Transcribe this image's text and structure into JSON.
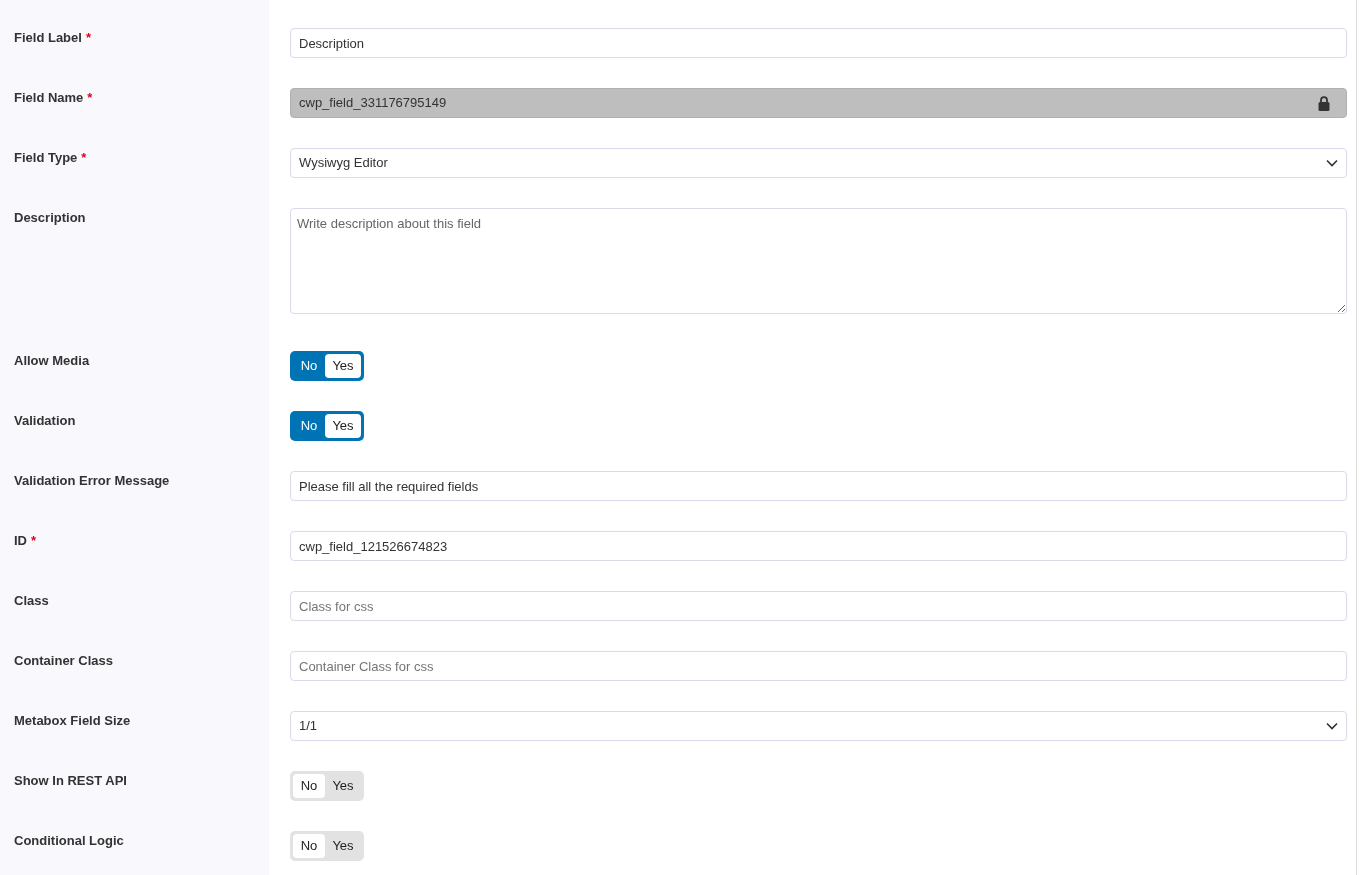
{
  "fields": [
    {
      "kind": "text",
      "label": "Field Label",
      "required_mark": "*",
      "value": "Description"
    },
    {
      "kind": "locked",
      "label": "Field Name",
      "required_mark": "*",
      "value": "cwp_field_331176795149"
    },
    {
      "kind": "select",
      "label": "Field Type",
      "required_mark": "*",
      "value": "Wysiwyg Editor"
    },
    {
      "kind": "textarea",
      "label": "Description",
      "placeholder": "Write description about this field"
    },
    {
      "kind": "toggle",
      "label": "Allow Media",
      "off_label": "No",
      "on_label": "Yes",
      "on": true
    },
    {
      "kind": "toggle",
      "label": "Validation",
      "off_label": "No",
      "on_label": "Yes",
      "on": true
    },
    {
      "kind": "text",
      "label": "Validation Error Message",
      "value": "Please fill all the required fields"
    },
    {
      "kind": "text",
      "label": "ID",
      "required_mark": "*",
      "value": "cwp_field_121526674823"
    },
    {
      "kind": "text",
      "label": "Class",
      "placeholder": "Class for css"
    },
    {
      "kind": "text",
      "label": "Container Class",
      "placeholder": "Container Class for css"
    },
    {
      "kind": "select",
      "label": "Metabox Field Size",
      "value": "1/1"
    },
    {
      "kind": "toggle",
      "label": "Show In REST API",
      "off_label": "No",
      "on_label": "Yes",
      "on": false
    },
    {
      "kind": "toggle",
      "label": "Conditional Logic",
      "off_label": "No",
      "on_label": "Yes",
      "on": false
    }
  ]
}
